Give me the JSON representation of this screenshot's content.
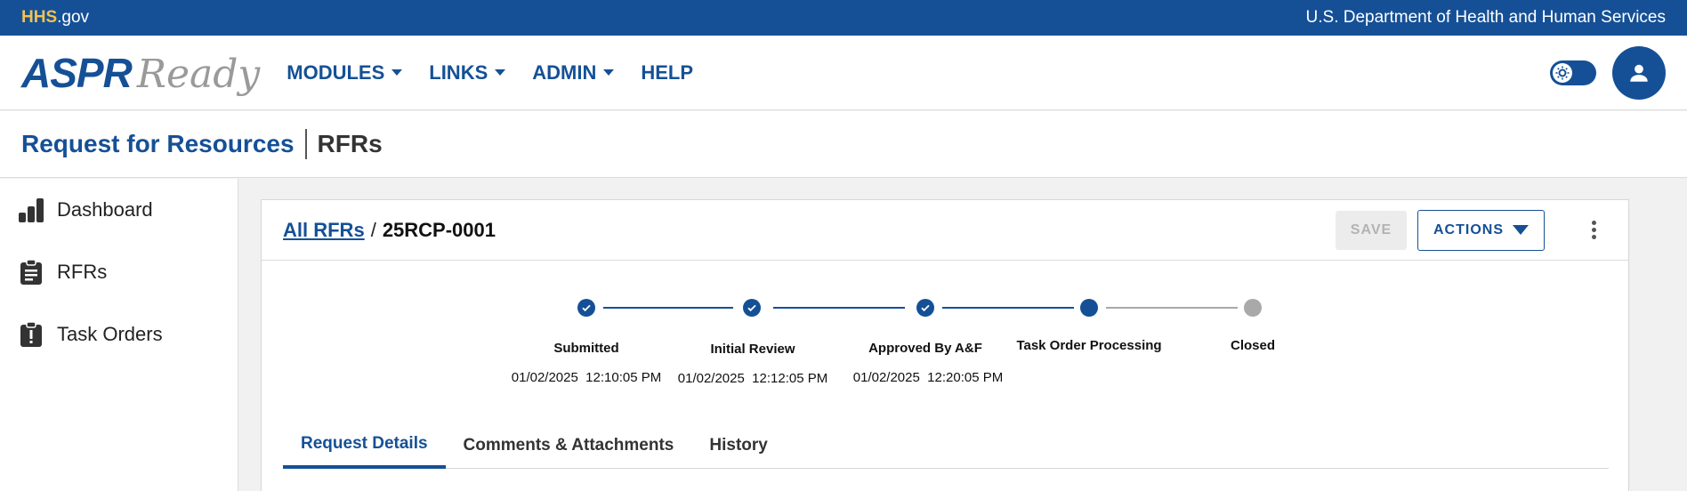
{
  "topbar": {
    "agency_bold": "HHS",
    "agency_suffix": ".gov",
    "department": "U.S. Department of Health and Human Services"
  },
  "brand": {
    "name_bold": "ASPR",
    "name_script": "Ready"
  },
  "nav": {
    "items": [
      {
        "label": "MODULES",
        "has_menu": true
      },
      {
        "label": "LINKS",
        "has_menu": true
      },
      {
        "label": "ADMIN",
        "has_menu": true
      },
      {
        "label": "HELP",
        "has_menu": false
      }
    ]
  },
  "page": {
    "title": "Request for Resources",
    "subtitle": "RFRs"
  },
  "sidebar": {
    "items": [
      {
        "label": "Dashboard",
        "icon": "bar-chart-icon"
      },
      {
        "label": "RFRs",
        "icon": "clipboard-icon"
      },
      {
        "label": "Task Orders",
        "icon": "alert-clipboard-icon"
      }
    ]
  },
  "record": {
    "breadcrumb_link": "All RFRs",
    "breadcrumb_sep": "/",
    "id": "25RCP-0001",
    "save_label": "SAVE",
    "actions_label": "ACTIONS"
  },
  "stepper": {
    "steps": [
      {
        "label": "Submitted",
        "date": "01/02/2025  12:10:05 PM",
        "status": "complete"
      },
      {
        "label": "Initial Review",
        "date": "01/02/2025  12:12:05 PM",
        "status": "complete"
      },
      {
        "label": "Approved By A&F",
        "date": "01/02/2025  12:20:05 PM",
        "status": "complete"
      },
      {
        "label": "Task Order Processing",
        "date": "",
        "status": "current"
      },
      {
        "label": "Closed",
        "date": "",
        "status": "pending"
      }
    ]
  },
  "tabs": [
    {
      "label": "Request Details",
      "active": true
    },
    {
      "label": "Comments & Attachments",
      "active": false
    },
    {
      "label": "History",
      "active": false
    }
  ],
  "colors": {
    "primary": "#155096",
    "accent": "#f2c14e",
    "pending": "#a9a9a9"
  }
}
